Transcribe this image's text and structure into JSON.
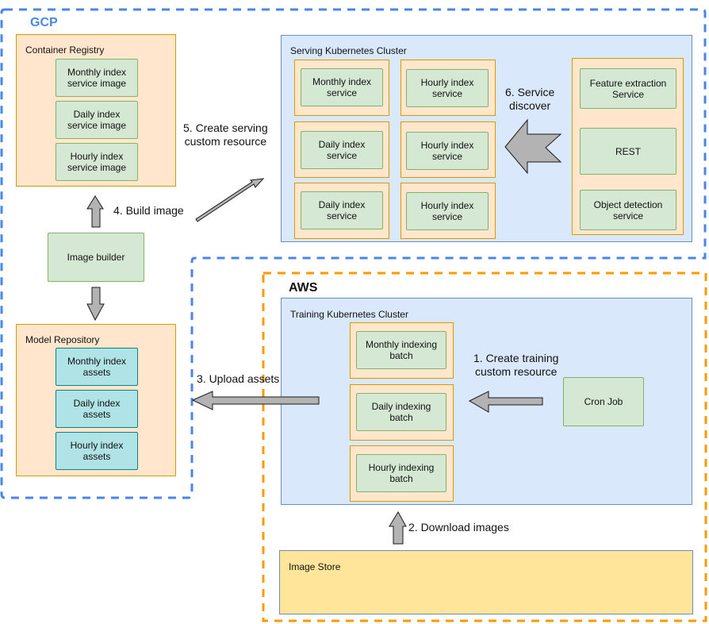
{
  "regions": {
    "gcp": {
      "label": "GCP",
      "color": "#4285f4"
    },
    "aws": {
      "label": "AWS",
      "color": "#ff9900"
    }
  },
  "container_registry": {
    "title": "Container Registry",
    "items": [
      "Monthly index\nservice image",
      "Daily index\nservice image",
      "Hourly index\nservice image"
    ]
  },
  "image_builder": {
    "label": "Image builder"
  },
  "model_repository": {
    "title": "Model Repository",
    "items": [
      "Monthly index\nassets",
      "Daily index\nassets",
      "Hourly index\nassets"
    ]
  },
  "serving_cluster": {
    "title": "Serving Kubernetes Cluster",
    "left_column": [
      "Monthly index\nservice",
      "Daily index\nservice",
      "Daily index\nservice"
    ],
    "right_column": [
      "Hourly index\nservice",
      "Hourly index\nservice",
      "Hourly index\nservice"
    ],
    "support_services": [
      "Feature extraction\nService",
      "REST",
      "Object detection\nservice"
    ]
  },
  "training_cluster": {
    "title": "Training Kubernetes Cluster",
    "batches": [
      "Monthly indexing\nbatch",
      "Daily indexing\nbatch",
      "Hourly indexing\nbatch"
    ],
    "cron_job": "Cron Job"
  },
  "image_store": {
    "title": "Image Store"
  },
  "steps": {
    "s1": "1. Create training\ncustom resource",
    "s2": "2. Download images",
    "s3": "3. Upload assets",
    "s4": "4. Build image",
    "s5": "5. Create serving\ncustom resource",
    "s6": "6. Service\ndiscover"
  },
  "colors": {
    "arrow_fill": "#b3b3b3",
    "arrow_stroke": "#1a1a1a"
  }
}
